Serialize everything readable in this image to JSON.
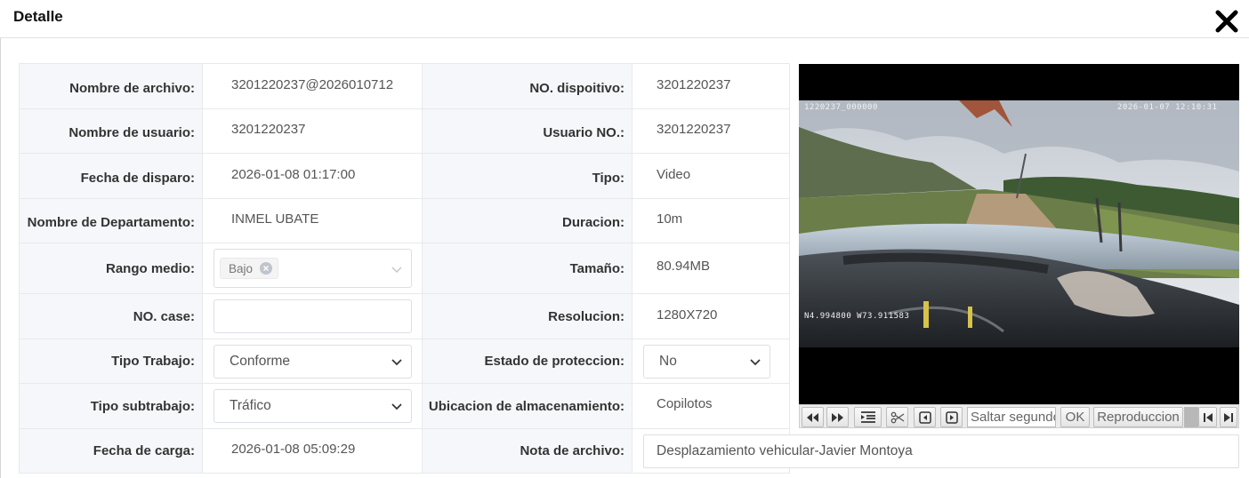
{
  "dialog": {
    "title": "Detalle"
  },
  "fields": {
    "nombre_archivo": {
      "label": "Nombre de archivo:",
      "value": "3201220237@2026010712"
    },
    "no_dispositivo": {
      "label": "NO. dispoitivo:",
      "value": "3201220237"
    },
    "nombre_usuario": {
      "label": "Nombre de usuario:",
      "value": "3201220237"
    },
    "usuario_no": {
      "label": "Usuario NO.:",
      "value": "3201220237"
    },
    "fecha_disparo": {
      "label": "Fecha de disparo:",
      "value": "2026-01-08 01:17:00"
    },
    "tipo": {
      "label": "Tipo:",
      "value": "Video"
    },
    "departamento": {
      "label": "Nombre de Departamento:",
      "value": "INMEL UBATE"
    },
    "duracion": {
      "label": "Duracion:",
      "value": "10m"
    },
    "rango_medio": {
      "label": "Rango medio:",
      "tag": "Bajo"
    },
    "tamano": {
      "label": "Tamaño:",
      "value": "80.94MB"
    },
    "no_case": {
      "label": "NO. case:",
      "value": ""
    },
    "resolucion": {
      "label": "Resolucion:",
      "value": "1280X720"
    },
    "tipo_trabajo": {
      "label": "Tipo Trabajo:",
      "value": "Conforme"
    },
    "estado_proteccion": {
      "label": "Estado de proteccion:",
      "value": "No"
    },
    "tipo_subtrabajo": {
      "label": "Tipo subtrabajo:",
      "value": "Tráfico"
    },
    "ubicacion": {
      "label": "Ubicacion de almacenamiento:",
      "value": "Copilotos"
    },
    "fecha_carga": {
      "label": "Fecha de carga:",
      "value": "2026-01-08 05:09:29"
    },
    "nota_archivo": {
      "label": "Nota de archivo:",
      "value": "Desplazamiento vehicular-Javier Montoya"
    }
  },
  "player": {
    "osd_device": "1220237_000000",
    "osd_datetime": "2026-01-07  12:10:31",
    "osd_gps": "N4.994800  W73.911583",
    "seek_placeholder": "Saltar segundo",
    "ok_label": "OK",
    "playback_label": "Reproduccion",
    "icons": [
      "rewind-icon",
      "fast-forward-icon",
      "playlist-icon",
      "scissors-icon",
      "prev-frame-icon",
      "next-frame-icon",
      "skip-start-icon",
      "skip-end-icon"
    ]
  },
  "colors": {
    "label_bg": "#f5f7fa",
    "border": "#e8e9ec",
    "player_bg": "#000000"
  }
}
